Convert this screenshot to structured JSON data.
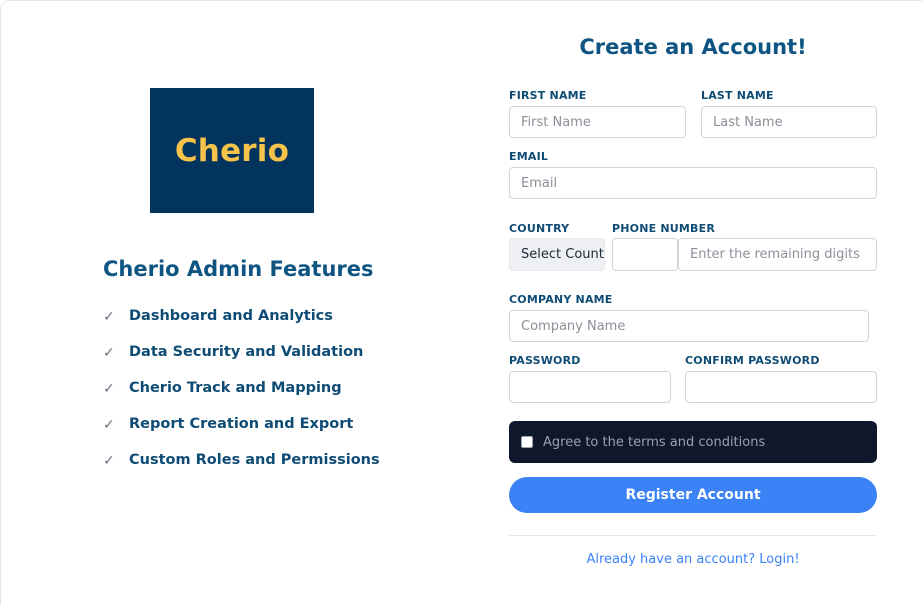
{
  "brand": {
    "logo_text": "Cherio",
    "logo_bg": "#03345e",
    "logo_fg": "#f5c24a"
  },
  "features": {
    "title": "Cherio Admin Features",
    "items": [
      {
        "icon": "check-icon",
        "glyph": "✓",
        "label": "Dashboard and Analytics"
      },
      {
        "icon": "check-icon",
        "glyph": "✓",
        "label": "Data Security and Validation"
      },
      {
        "icon": "check-icon",
        "glyph": "✓",
        "label": "Cherio Track and Mapping"
      },
      {
        "icon": "check-icon",
        "glyph": "✓",
        "label": "Report Creation and Export"
      },
      {
        "icon": "check-icon",
        "glyph": "✓",
        "label": "Custom Roles and Permissions"
      }
    ]
  },
  "form": {
    "title": "Create an Account!",
    "first_name": {
      "label": "FIRST NAME",
      "placeholder": "First Name",
      "value": ""
    },
    "last_name": {
      "label": "LAST NAME",
      "placeholder": "Last Name",
      "value": ""
    },
    "email": {
      "label": "EMAIL",
      "placeholder": "Email",
      "value": ""
    },
    "country": {
      "label": "COUNTRY",
      "selected": "Select Count"
    },
    "phone": {
      "label": "PHONE NUMBER",
      "code_value": "",
      "placeholder": "Enter the remaining digits",
      "value": ""
    },
    "company": {
      "label": "COMPANY NAME",
      "placeholder": "Company Name",
      "value": ""
    },
    "password": {
      "label": "PASSWORD",
      "value": ""
    },
    "confirm_password": {
      "label": "CONFIRM PASSWORD",
      "value": ""
    },
    "terms": {
      "label": "Agree to the terms and conditions",
      "checked": false
    },
    "register_label": "Register Account",
    "login_link": "Already have an account? Login!"
  },
  "colors": {
    "heading": "#0f5583",
    "accent": "#3b82f6",
    "terms_bg": "#0f172a"
  }
}
